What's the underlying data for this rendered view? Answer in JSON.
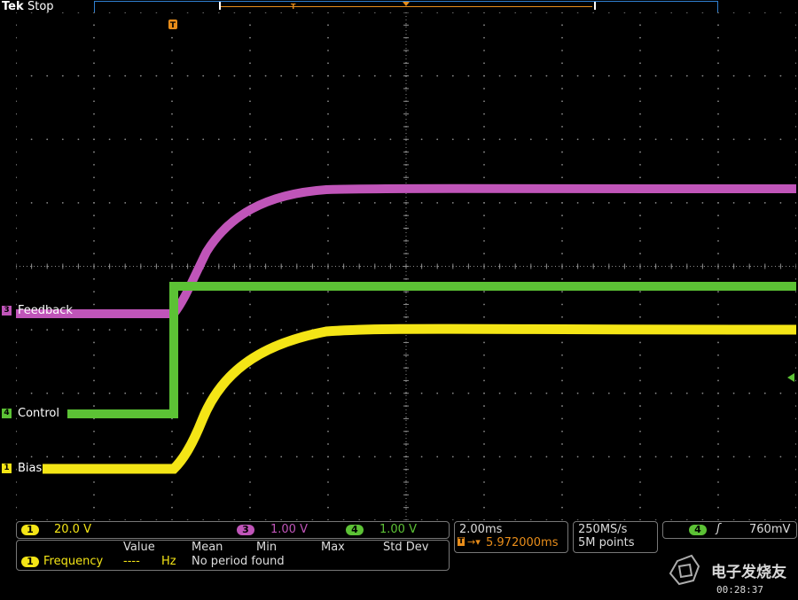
{
  "header": {
    "brand": "Tek",
    "run_state": "Stop",
    "trigger_marker": "T"
  },
  "colors": {
    "ch1": "#f4e516",
    "ch3": "#c055b9",
    "ch4": "#5cc235",
    "trigger": "#e88d1a",
    "grid": "#8a8a8a"
  },
  "channels": [
    {
      "id": "3",
      "name": "Feedback",
      "scale": "1.00 V",
      "color": "#c055b9"
    },
    {
      "id": "4",
      "name": "Control",
      "scale": "1.00 V",
      "color": "#5cc235"
    },
    {
      "id": "1",
      "name": "Bias",
      "scale": "20.0 V",
      "color": "#f4e516"
    }
  ],
  "ch1_scale": "20.0 V",
  "ch3_scale": "1.00 V",
  "ch4_scale": "1.00 V",
  "horizontal": {
    "scale": "2.00ms",
    "delay": "5.972000ms",
    "sample_rate": "250MS/s",
    "record_length": "5M points"
  },
  "trigger": {
    "source": "4",
    "slope_icon": "rising-edge-icon",
    "level": "760mV"
  },
  "measurement": {
    "headers": [
      "Value",
      "Mean",
      "Min",
      "Max",
      "Std Dev"
    ],
    "channel": "1",
    "name": "Frequency",
    "value": "----",
    "unit": "Hz",
    "note": "No period found"
  },
  "clock": "00:28:37",
  "watermark": "电子发烧友"
}
